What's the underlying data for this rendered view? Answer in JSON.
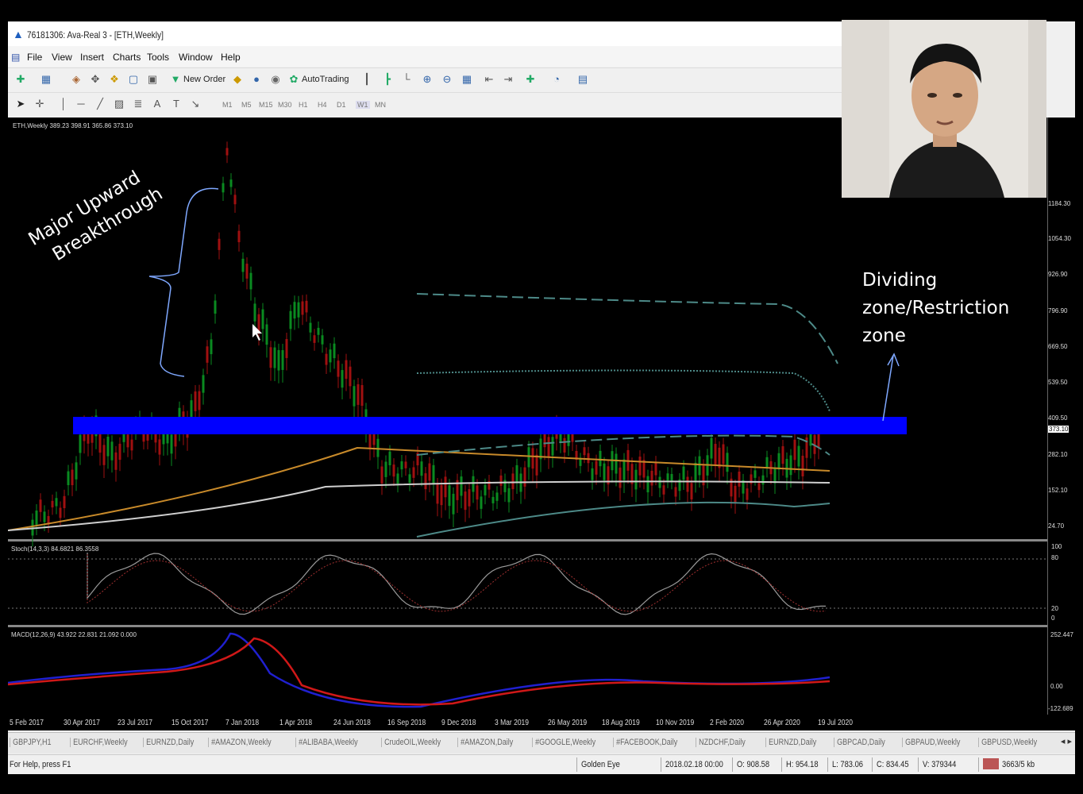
{
  "window": {
    "title": "76181306: Ava-Real 3 - [ETH,Weekly]"
  },
  "menu": {
    "items": [
      "File",
      "View",
      "Insert",
      "Charts",
      "Tools",
      "Window",
      "Help"
    ]
  },
  "toolbar": {
    "new_order": "New Order",
    "autotrading": "AutoTrading",
    "timeframes": [
      "M1",
      "M5",
      "M15",
      "M30",
      "H1",
      "H4",
      "D1",
      "W1",
      "MN"
    ]
  },
  "chart": {
    "header": "ETH,Weekly  389.23 398.91 365.86 373.10",
    "current_price": "373.10",
    "price_labels": [
      "1184.30",
      "1054.30",
      "926.90",
      "796.90",
      "669.50",
      "539.50",
      "409.50",
      "282.10",
      "152.10",
      "24.70"
    ],
    "stoch_label": "Stoch(14,3,3) 84.6821 86.3558",
    "stoch_levels": [
      "100",
      "80",
      "20",
      "0"
    ],
    "macd_label": "MACD(12,26,9) 43.922 22.831 21.092 0.000",
    "macd_levels": [
      "252.447",
      "0.00",
      "-122.689"
    ],
    "dates": [
      "5 Feb 2017",
      "30 Apr 2017",
      "23 Jul 2017",
      "15 Oct 2017",
      "7 Jan 2018",
      "1 Apr 2018",
      "24 Jun 2018",
      "16 Sep 2018",
      "9 Dec 2018",
      "3 Mar 2019",
      "26 May 2019",
      "18 Aug 2019",
      "10 Nov 2019",
      "2 Feb 2020",
      "26 Apr 2020",
      "19 Jul 2020"
    ]
  },
  "annotations": {
    "breakthrough_line1": "Major Upward",
    "breakthrough_line2": "Breakthrough",
    "dividing_text": "Dividing zone/Restriction zone",
    "zone_color": "#0000ff"
  },
  "tabs": [
    "GBPJPY,H1",
    "EURCHF,Weekly",
    "EURNZD,Daily",
    "#AMAZON,Weekly",
    "#ALIBABA,Weekly",
    "CrudeOIL,Weekly",
    "#AMAZON,Daily",
    "#GOOGLE,Weekly",
    "#FACEBOOK,Daily",
    "NZDCHF,Daily",
    "EURNZD,Daily",
    "GBPCAD,Daily",
    "GBPAUD,Weekly",
    "GBPUSD,Weekly"
  ],
  "status": {
    "help": "For Help, press F1",
    "profile": "Golden Eye",
    "datetime": "2018.02.18 00:00",
    "open": "O: 908.58",
    "high": "H: 954.18",
    "low": "L: 783.06",
    "close": "C: 834.45",
    "volume": "V: 379344",
    "traffic": "3663/5 kb"
  }
}
